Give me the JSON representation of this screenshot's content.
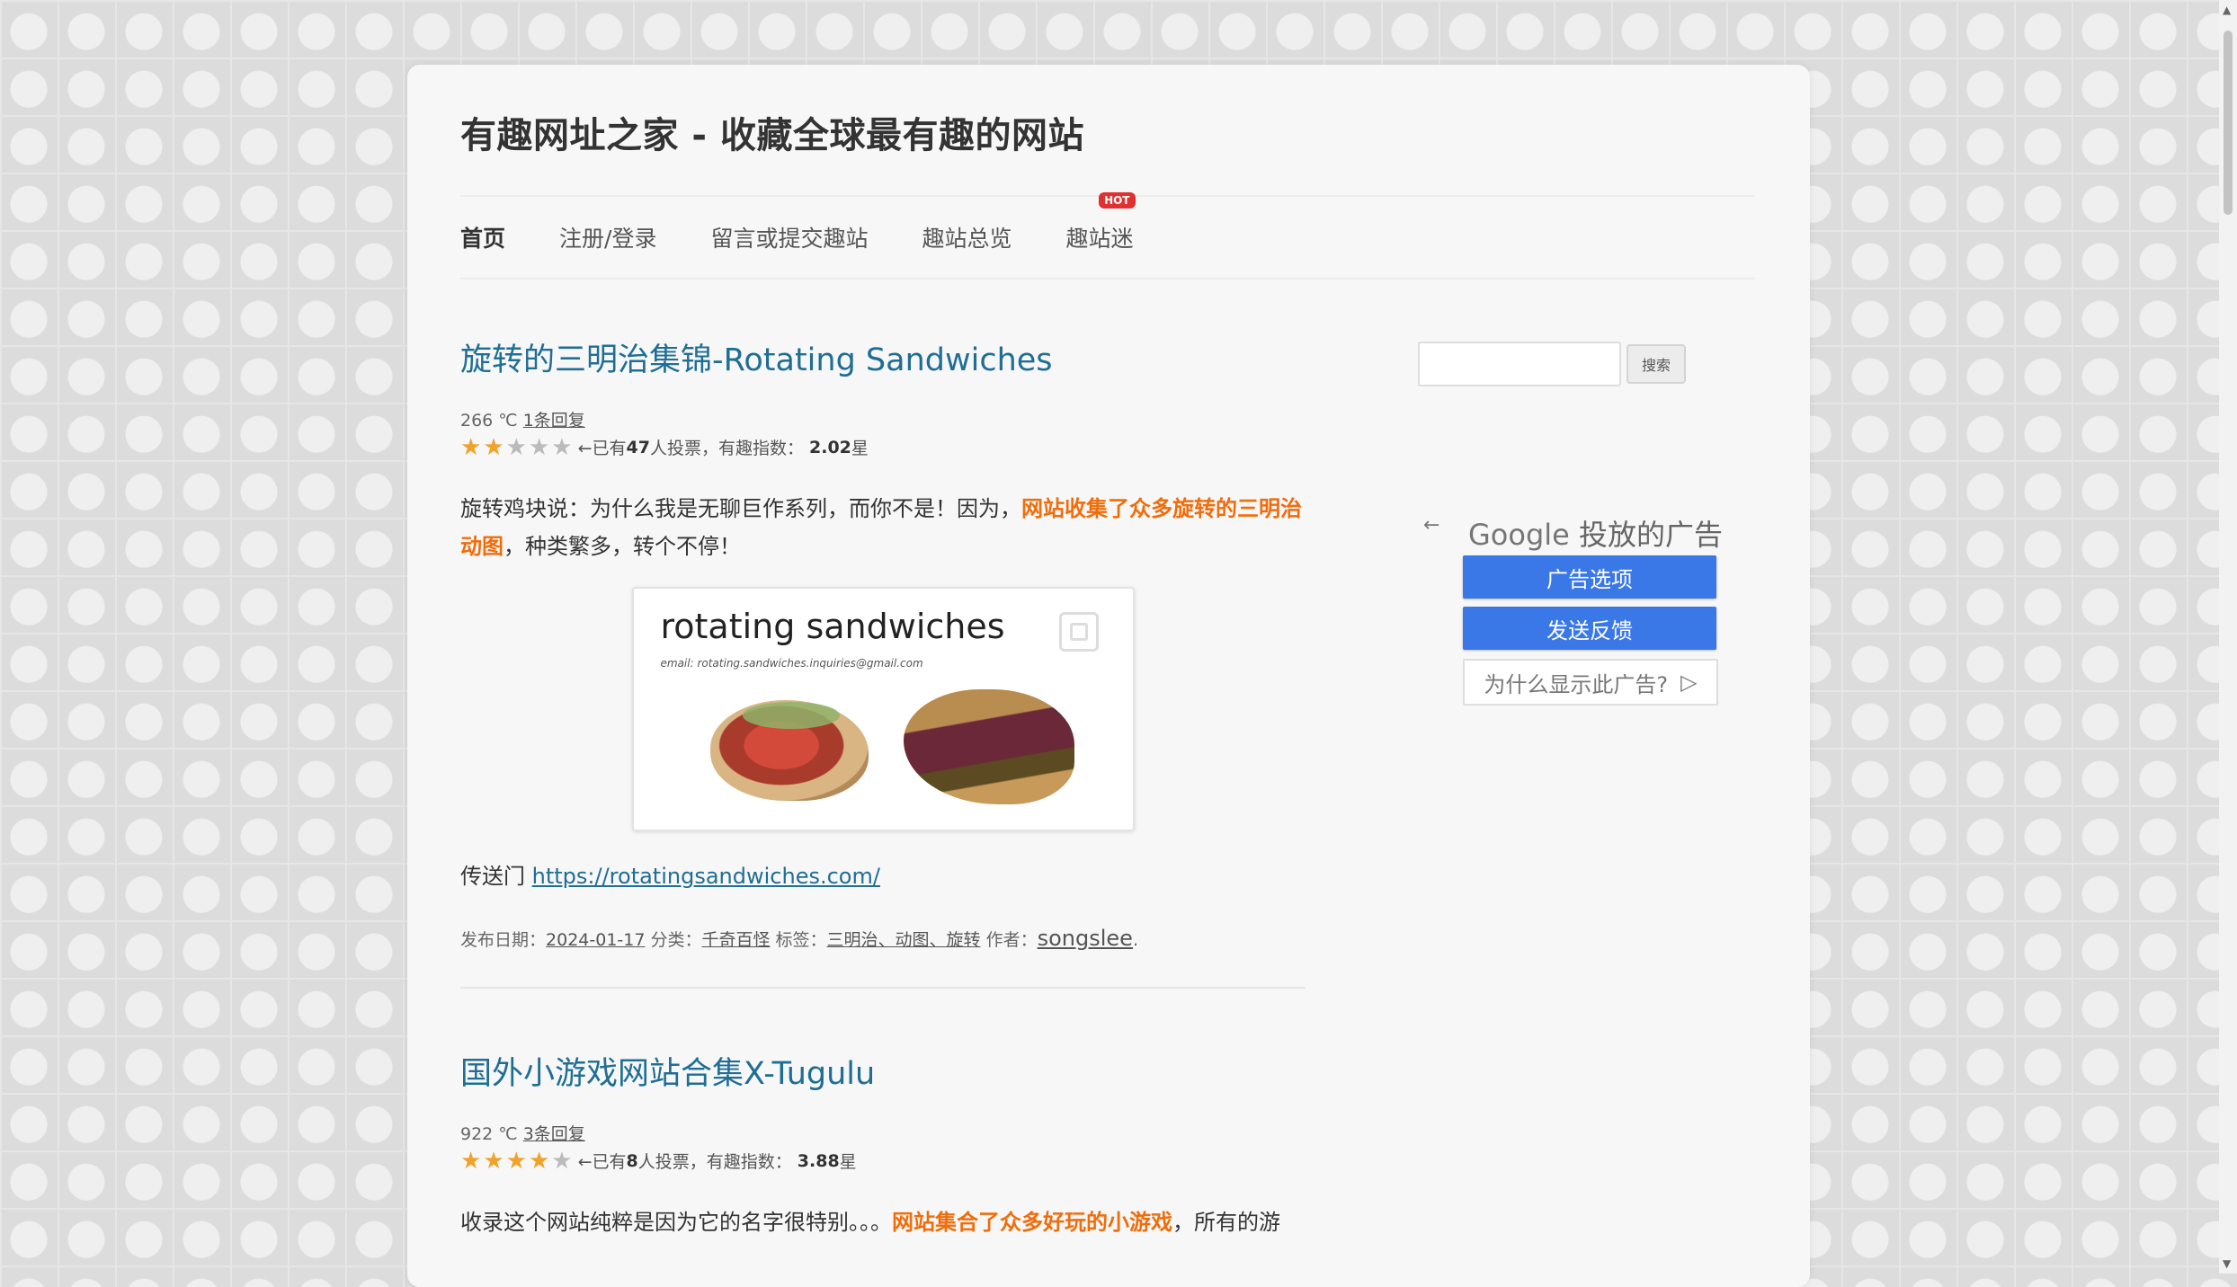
{
  "site": {
    "title": "有趣网址之家 - 收藏全球最有趣的网站"
  },
  "nav": {
    "items": [
      {
        "label": "首页"
      },
      {
        "label": "注册/登录"
      },
      {
        "label": "留言或提交趣站"
      },
      {
        "label": "趣站总览"
      },
      {
        "label": "趣站迷",
        "badge": "HOT"
      }
    ]
  },
  "posts": [
    {
      "title": "旋转的三明治集锦-Rotating Sandwiches",
      "views": "266 ℃",
      "comments": "1条回复",
      "rating_prefix": "←已有",
      "votes": "47",
      "rating_middle": " 人投票，有趣指数：",
      "score": "2.02",
      "score_suffix": "星",
      "stars": 2,
      "excerpt_before": "旋转鸡块说：为什么我是无聊巨作系列，而你不是！因为，",
      "excerpt_highlight": "网站收集了众多旋转的三明治动图",
      "excerpt_after": "，种类繁多，转个不停！",
      "image": {
        "title": "rotating sandwiches",
        "email": "email: rotating.sandwiches.inquiries@gmail.com"
      },
      "portal_label": "传送门 ",
      "portal_url": "https://rotatingsandwiches.com/",
      "date_label": "发布日期：",
      "date": "2024-01-17",
      "category_label": " 分类：",
      "category": "千奇百怪",
      "tags_label": " 标签：",
      "tags": "三明治、动图、旋转",
      "author_label": " 作者：",
      "author": "songslee",
      "period": "."
    },
    {
      "title": "国外小游戏网站合集X-Tugulu",
      "views": "922 ℃",
      "comments": "3条回复",
      "rating_prefix": "←已有",
      "votes": "8",
      "rating_middle": " 人投票，有趣指数：",
      "score": "3.88",
      "score_suffix": "星",
      "stars": 4,
      "excerpt_before": "收录这个网站纯粹是因为它的名字很特别。。。",
      "excerpt_highlight": "网站集合了众多好玩的小游戏",
      "excerpt_after": "，所有的游"
    }
  ],
  "sidebar": {
    "search_button": "搜索",
    "ad": {
      "back_icon": "arrow-left-icon",
      "brand": "Google",
      "header": " 投放的广告",
      "options_button": "广告选项",
      "feedback_button": "发送反馈",
      "why_button": "为什么显示此广告?",
      "why_icon": "play-outline-icon"
    }
  },
  "colors": {
    "link": "#1f6e95",
    "highlight": "#f06d0c",
    "star": "#f0a22b",
    "ad_button": "#3b78e7",
    "hot_badge": "#e03030"
  }
}
